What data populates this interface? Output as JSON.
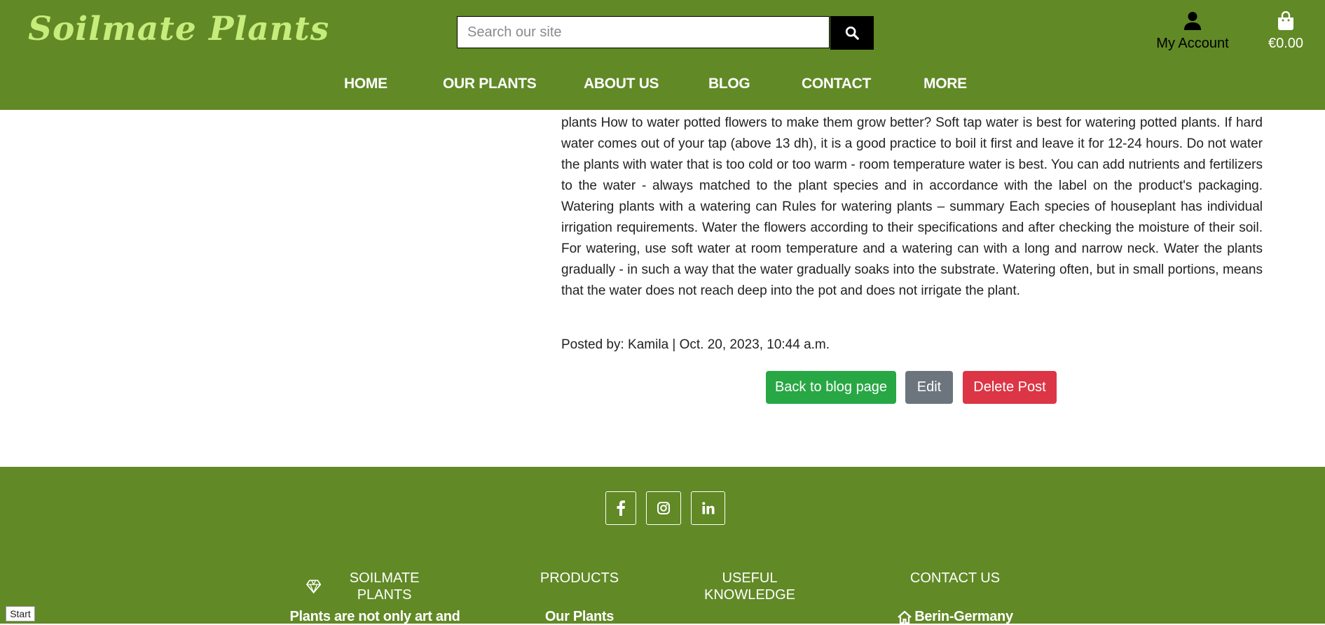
{
  "header": {
    "logo": "Soilmate Plants",
    "search": {
      "placeholder": "Search our site"
    },
    "account_label": "My Account",
    "cart_total": "€0.00",
    "nav": [
      "HOME",
      "OUR PLANTS",
      "ABOUT US",
      "BLOG",
      "CONTACT",
      "MORE"
    ]
  },
  "article": {
    "body": "plants How to water potted flowers to make them grow better? Soft tap water is best for watering potted plants. If hard water comes out of your tap (above 13 dh), it is a good practice to boil it first and leave it for 12-24 hours. Do not water the plants with water that is too cold or too warm - room temperature water is best. You can add nutrients and fertilizers to the water - always matched to the plant species and in accordance with the label on the product's packaging. Watering plants with a watering can Rules for watering plants – summary Each species of houseplant has individual irrigation requirements. Water the flowers according to their specifications and after checking the moisture of their soil. For watering, use soft water at room temperature and a watering can with a long and narrow neck. Water the plants gradually - in such a way that the water gradually soaks into the substrate. Watering often, but in small portions, means that the water does not reach deep into the pot and does not irrigate the plant.",
    "posted_by": "Posted by: Kamila | Oct. 20, 2023, 10:44 a.m.",
    "buttons": {
      "back": "Back to blog page",
      "edit": "Edit",
      "delete": "Delete Post"
    }
  },
  "footer": {
    "social_icons": [
      "facebook-icon",
      "instagram-icon",
      "linkedin-icon"
    ],
    "columns": [
      {
        "heading": "SOILMATE PLANTS",
        "sub": "Plants are not only art and"
      },
      {
        "heading": "PRODUCTS",
        "sub": "Our Plants"
      },
      {
        "heading": "USEFUL KNOWLEDGE",
        "sub": ""
      },
      {
        "heading": "CONTACT US",
        "sub": "Berin-Germany"
      }
    ]
  },
  "overlay": {
    "start_label": "Start"
  },
  "colors": {
    "brand_green": "#618926",
    "logo_green": "#c6ec7c",
    "success": "#28a745",
    "secondary": "#6c757d",
    "danger": "#dc3545"
  }
}
